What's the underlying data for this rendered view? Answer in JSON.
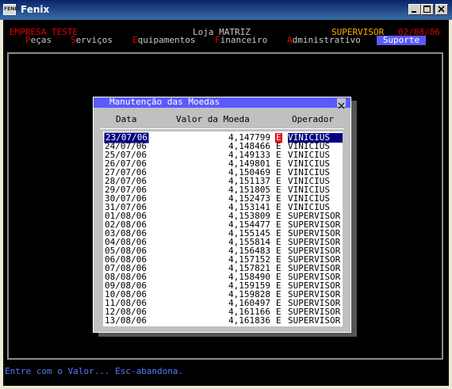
{
  "window": {
    "title": "Fenix",
    "icon_text": "FENIX",
    "icon": "fenix-app-icon"
  },
  "header": {
    "company": "EMPRESA TESTE",
    "store": "Loja MATRIZ",
    "user": "SUPERVISOR",
    "date": "02/08/06"
  },
  "menu": [
    {
      "hotkey": "P",
      "rest": "eças"
    },
    {
      "hotkey": "S",
      "rest": "erviços"
    },
    {
      "hotkey": "E",
      "rest": "quipamentos"
    },
    {
      "hotkey": "F",
      "rest": "inanceiro"
    },
    {
      "hotkey": "A",
      "rest": "dministrativo"
    },
    {
      "hotkey": "",
      "rest": "Suporte"
    }
  ],
  "dialog": {
    "title": "Manutenção das Moedas",
    "columns": {
      "date": "Data",
      "value": "Valor da Moeda",
      "operator": "Operador"
    },
    "rows": [
      {
        "date": "23/07/06",
        "value": "4,147799",
        "flag": "E",
        "operator": "VINICIUS"
      },
      {
        "date": "24/07/06",
        "value": "4,148466",
        "flag": "E",
        "operator": "VINICIUS"
      },
      {
        "date": "25/07/06",
        "value": "4,149133",
        "flag": "E",
        "operator": "VINICIUS"
      },
      {
        "date": "26/07/06",
        "value": "4,149801",
        "flag": "E",
        "operator": "VINICIUS"
      },
      {
        "date": "27/07/06",
        "value": "4,150469",
        "flag": "E",
        "operator": "VINICIUS"
      },
      {
        "date": "28/07/06",
        "value": "4,151137",
        "flag": "E",
        "operator": "VINICIUS"
      },
      {
        "date": "29/07/06",
        "value": "4,151805",
        "flag": "E",
        "operator": "VINICIUS"
      },
      {
        "date": "30/07/06",
        "value": "4,152473",
        "flag": "E",
        "operator": "VINICIUS"
      },
      {
        "date": "31/07/06",
        "value": "4,153141",
        "flag": "E",
        "operator": "VINICIUS"
      },
      {
        "date": "01/08/06",
        "value": "4,153809",
        "flag": "E",
        "operator": "SUPERVISOR"
      },
      {
        "date": "02/08/06",
        "value": "4,154477",
        "flag": "E",
        "operator": "SUPERVISOR"
      },
      {
        "date": "03/08/06",
        "value": "4,155145",
        "flag": "E",
        "operator": "SUPERVISOR"
      },
      {
        "date": "04/08/06",
        "value": "4,155814",
        "flag": "E",
        "operator": "SUPERVISOR"
      },
      {
        "date": "05/08/06",
        "value": "4,156483",
        "flag": "E",
        "operator": "SUPERVISOR"
      },
      {
        "date": "06/08/06",
        "value": "4,157152",
        "flag": "E",
        "operator": "SUPERVISOR"
      },
      {
        "date": "07/08/06",
        "value": "4,157821",
        "flag": "E",
        "operator": "SUPERVISOR"
      },
      {
        "date": "08/08/06",
        "value": "4,158490",
        "flag": "E",
        "operator": "SUPERVISOR"
      },
      {
        "date": "09/08/06",
        "value": "4,159159",
        "flag": "E",
        "operator": "SUPERVISOR"
      },
      {
        "date": "10/08/06",
        "value": "4,159828",
        "flag": "E",
        "operator": "SUPERVISOR"
      },
      {
        "date": "11/08/06",
        "value": "4,160497",
        "flag": "E",
        "operator": "SUPERVISOR"
      },
      {
        "date": "12/08/06",
        "value": "4,161166",
        "flag": "E",
        "operator": "SUPERVISOR"
      },
      {
        "date": "13/08/06",
        "value": "4,161836",
        "flag": "E",
        "operator": "SUPERVISOR"
      }
    ],
    "selected_index": 0
  },
  "status": "Entre com o Valor... Esc-abandona.",
  "colors": {
    "title_bar": "#0a246a",
    "menu_highlight": "#5a5aff",
    "hotkey": "#e00000",
    "user": "#ffaa00",
    "status": "#4f7fff",
    "selection": "#000080"
  }
}
